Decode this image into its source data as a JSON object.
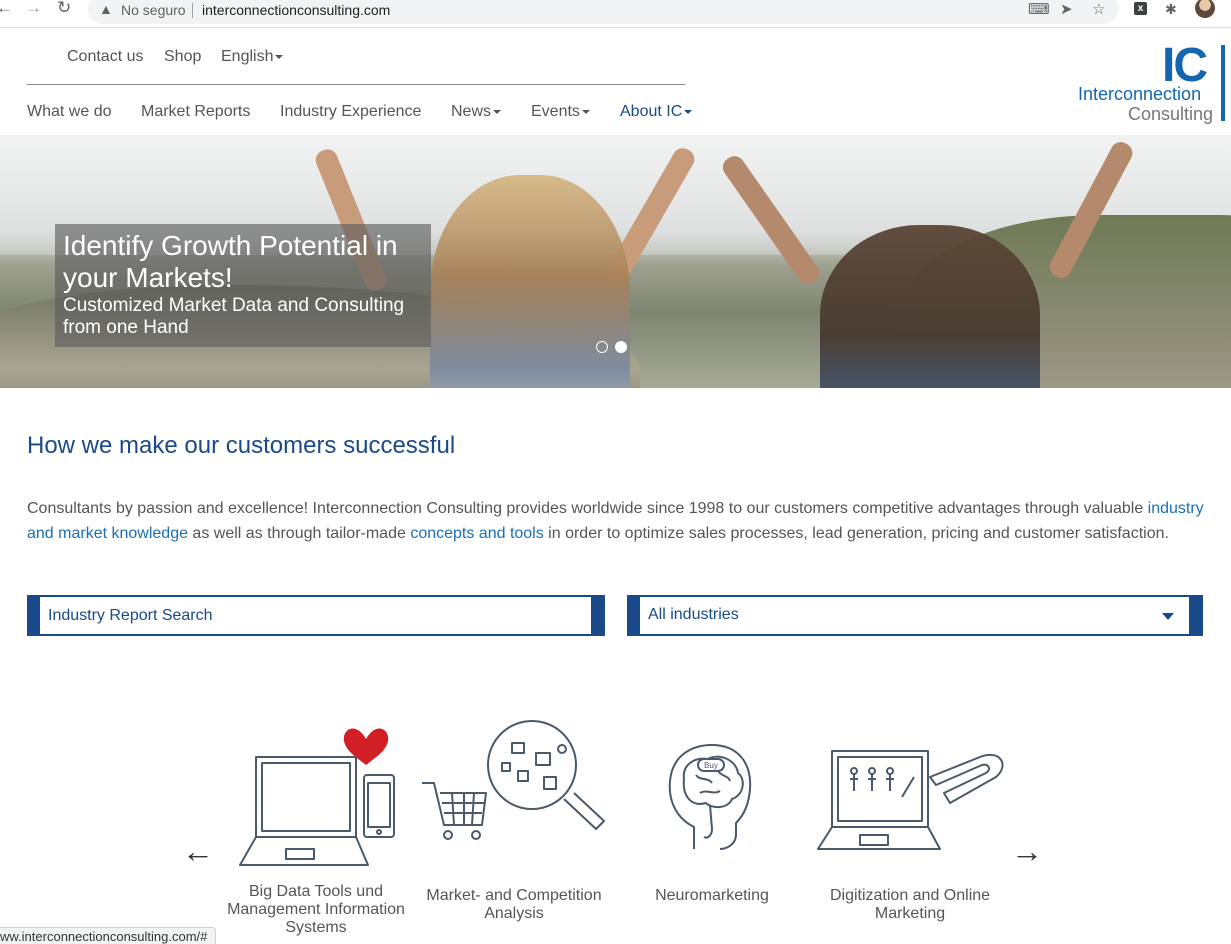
{
  "browser": {
    "security_label": "No seguro",
    "url": "interconnectionconsulting.com",
    "status_bar_url": "ww.interconnectionconsulting.com/#"
  },
  "header": {
    "top_links": [
      "Contact us",
      "Shop",
      "English"
    ],
    "main_nav": [
      "What we do",
      "Market Reports",
      "Industry Experience",
      "News",
      "Events",
      "About IC"
    ],
    "active_item": "About IC",
    "logo": {
      "mark": "IC",
      "line1": "Interconnection",
      "line2": "Consulting"
    }
  },
  "hero": {
    "title": "Identify Growth Potential in your Markets!",
    "subtitle": "Customized Market Data and Consulting from one Hand",
    "slide_count": 2,
    "active_slide": 2
  },
  "intro": {
    "heading": "How we make our customers successful",
    "text_a": "Consultants by passion and excellence! Interconnection Consulting provides worldwide since 1998 to our customers competitive advantages through valuable ",
    "link_1": "industry and market knowledge",
    "text_b": " as well as through tailor-made ",
    "link_2": "concepts and tools",
    "text_c": " in order to optimize sales processes, lead generation, pricing and customer satisfaction."
  },
  "search": {
    "placeholder": "Industry Report Search",
    "industry_select": "All industries"
  },
  "services": {
    "prev_arrow": "←",
    "next_arrow": "→",
    "items": [
      {
        "label": "Big Data Tools und Management Information Systems",
        "icon": "laptop-phone-heart-icon"
      },
      {
        "label": "Market- and Competition Analysis",
        "icon": "cart-magnifier-icon"
      },
      {
        "label": "Neuromarketing",
        "icon": "head-brain-icon"
      },
      {
        "label": "Digitization and Online Marketing",
        "icon": "laptop-magnet-icon"
      }
    ]
  },
  "colors": {
    "brand_blue": "#1a4a8a",
    "link_blue": "#1a6fb8",
    "logo_blue": "#1566b0",
    "heart_red": "#d21f26"
  }
}
